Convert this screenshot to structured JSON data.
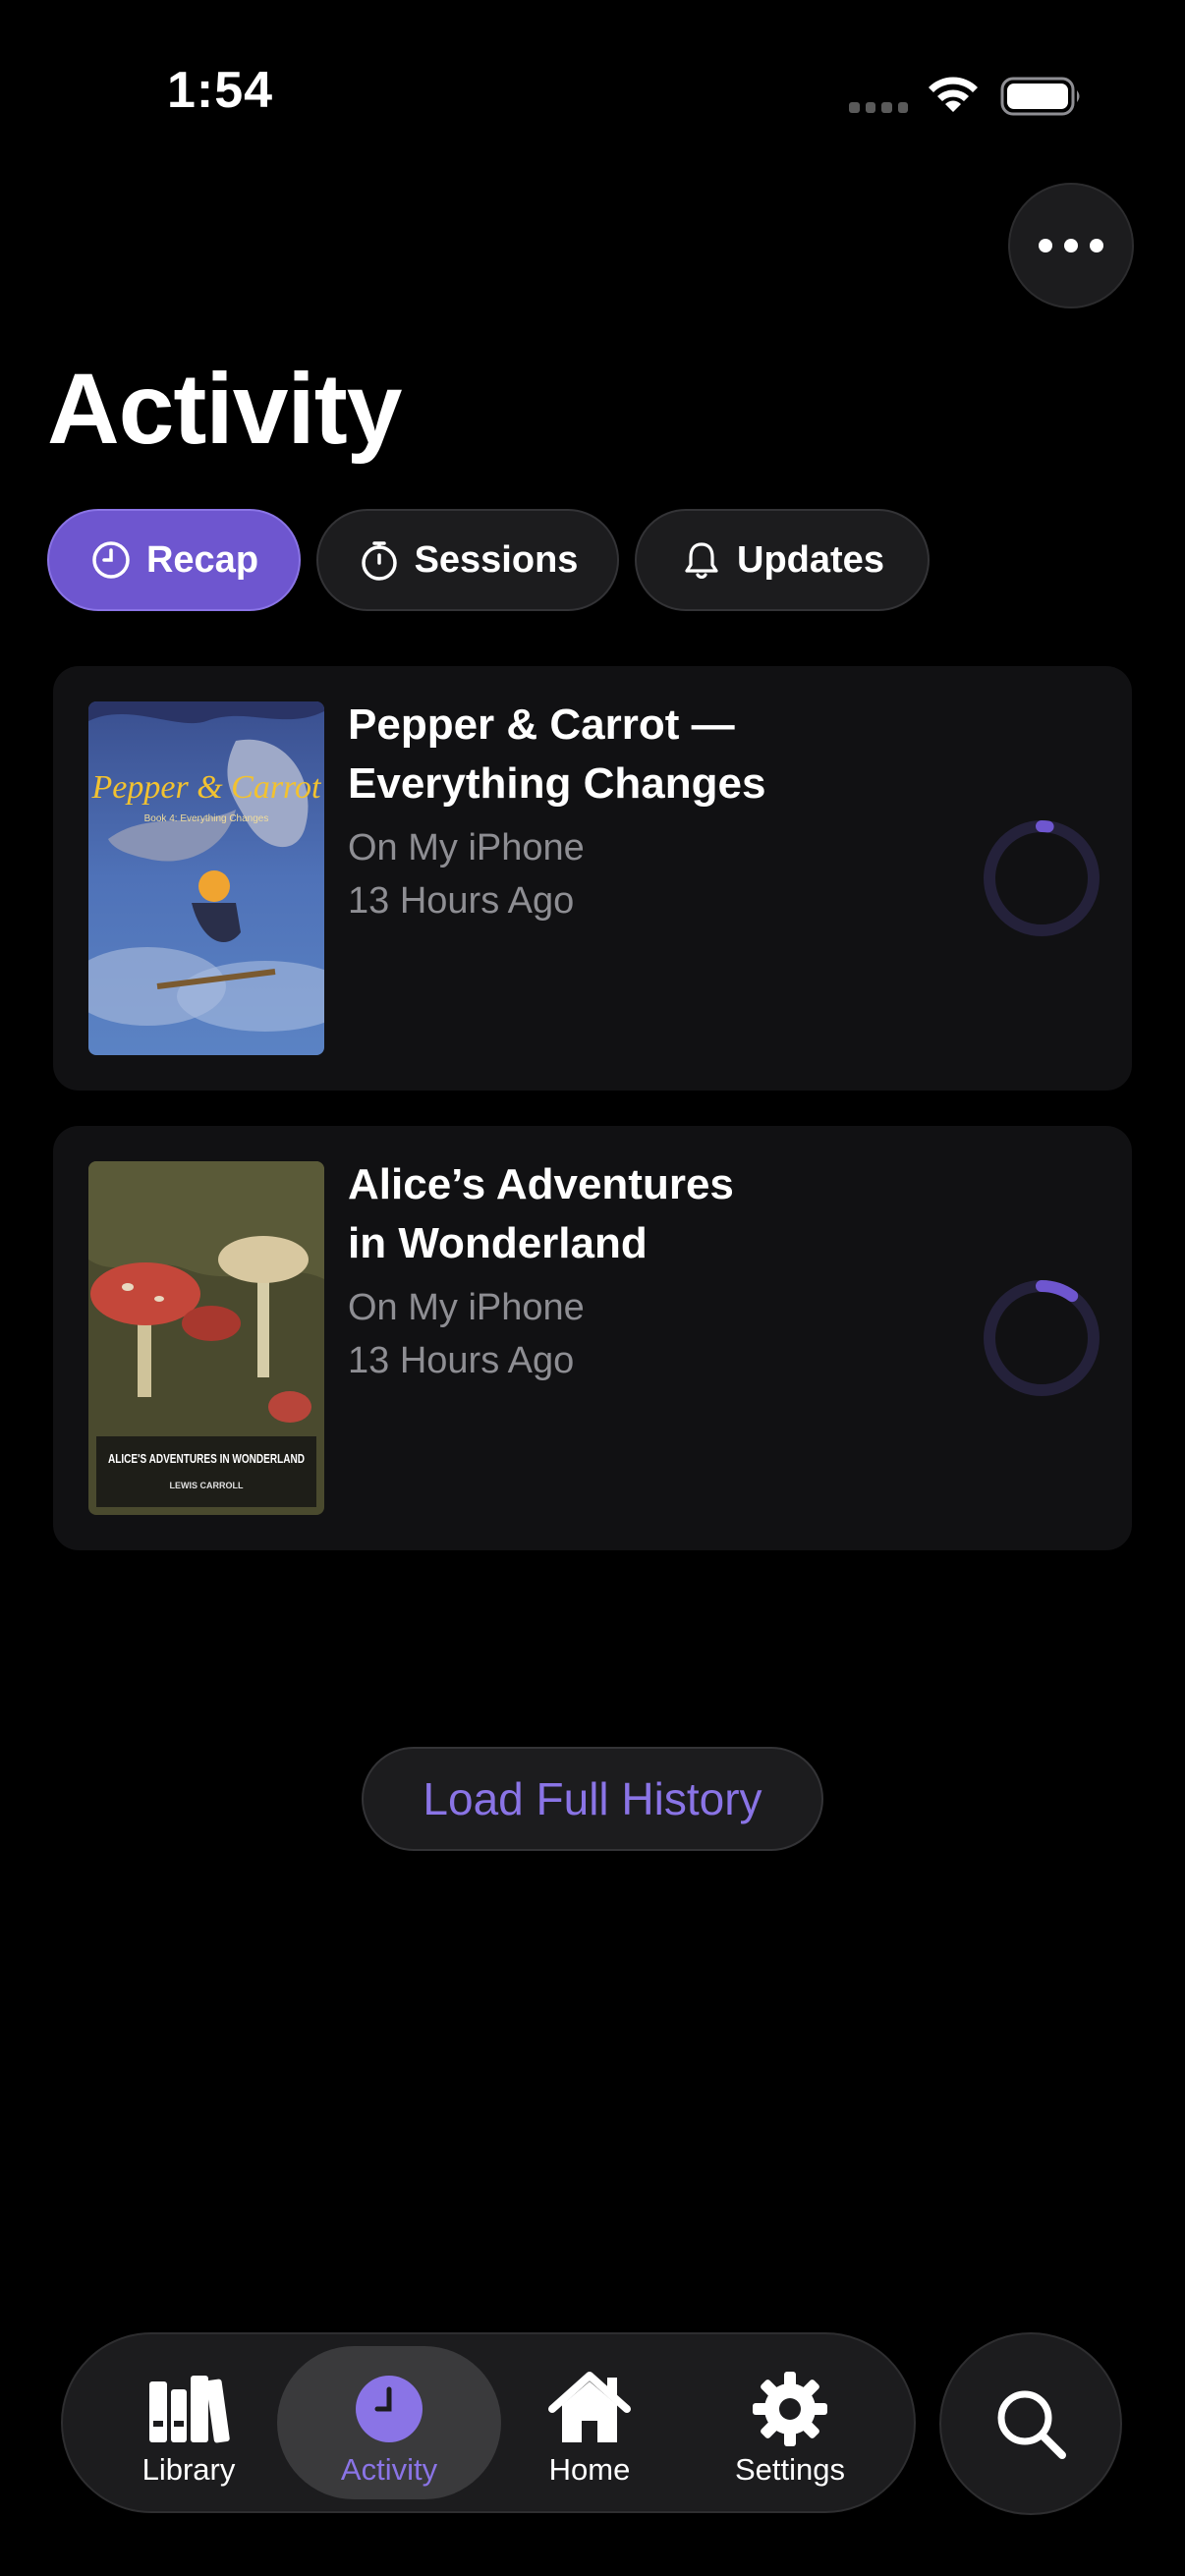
{
  "status_bar": {
    "time": "1:54"
  },
  "header": {
    "title": "Activity",
    "more_icon": "ellipsis-icon"
  },
  "segments": [
    {
      "label": "Recap",
      "icon": "clock-icon",
      "active": true
    },
    {
      "label": "Sessions",
      "icon": "stopwatch-icon",
      "active": false
    },
    {
      "label": "Updates",
      "icon": "bell-icon",
      "active": false
    }
  ],
  "items": [
    {
      "title_line1": "Pepper & Carrot —",
      "title_line2": "Everything Changes",
      "location": "On My iPhone",
      "time_ago": "13 Hours Ago",
      "progress": 0.02,
      "cover_title": "Pepper & Carrot",
      "cover_subtitle": "Book 4: Everything Changes"
    },
    {
      "title_line1": "Alice’s Adventures",
      "title_line2": "in Wonderland",
      "location": "On My iPhone",
      "time_ago": "13 Hours Ago",
      "progress": 0.1,
      "cover_title": "ALICE'S ADVENTURES IN WONDERLAND",
      "cover_author": "LEWIS CARROLL"
    }
  ],
  "load_history_label": "Load Full History",
  "tabbar": {
    "tabs": [
      {
        "label": "Library",
        "icon": "books-icon"
      },
      {
        "label": "Activity",
        "icon": "clock-icon",
        "active": true
      },
      {
        "label": "Home",
        "icon": "house-icon"
      },
      {
        "label": "Settings",
        "icon": "gear-icon"
      }
    ],
    "search_icon": "magnifying-glass-icon"
  },
  "colors": {
    "accent": "#6e56cf",
    "accent_text": "#8a74e6",
    "background": "#000000",
    "card": "#111113",
    "secondary_text": "#8e8e93"
  }
}
